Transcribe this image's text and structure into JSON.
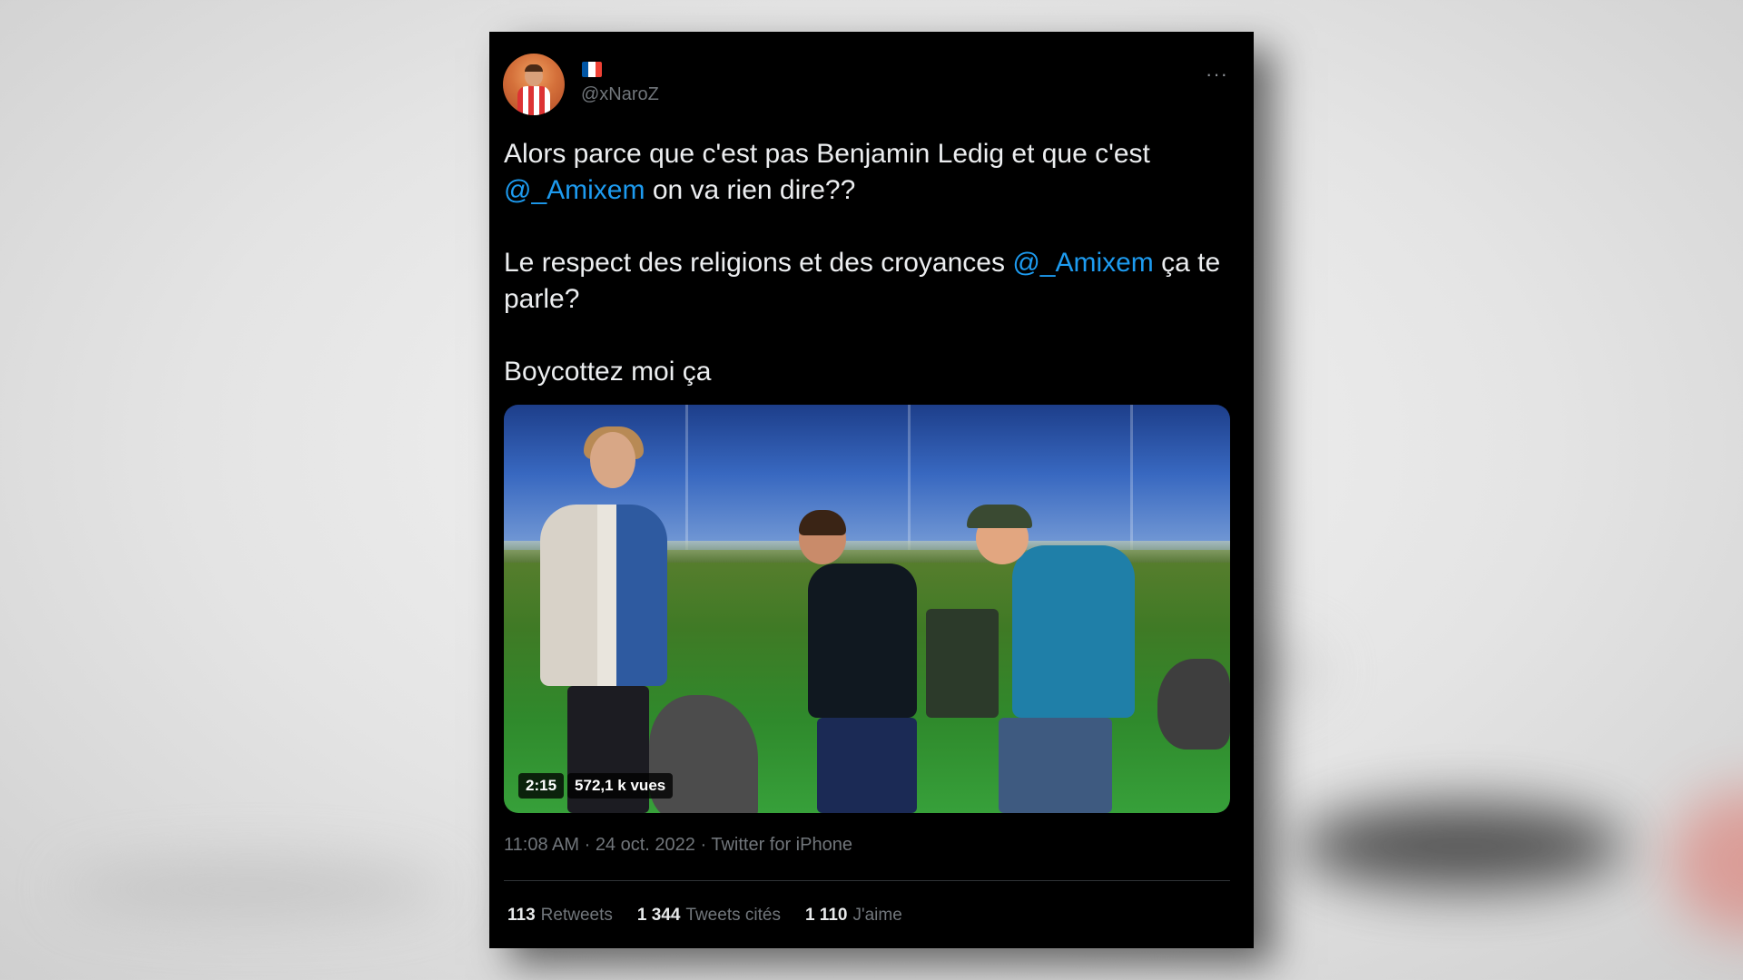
{
  "tweet": {
    "handle": "@xNaroZ",
    "flag_colors": [
      "#0055a4",
      "#ffffff",
      "#ef4135"
    ],
    "more_label": "···",
    "paragraphs": [
      {
        "before": "Alors parce que c'est pas Benjamin Ledig et que c'est ",
        "mention": "@_Amixem",
        "after": " on va rien dire??"
      },
      {
        "before": "Le respect des religions et des croyances ",
        "mention": "@_Amixem",
        "after": " ça te parle?"
      },
      {
        "before": "Boycottez moi ça",
        "mention": "",
        "after": ""
      }
    ],
    "video": {
      "duration": "2:15",
      "views": "572,1 k vues"
    },
    "time": "11:08 AM",
    "date": "24 oct. 2022",
    "source": "Twitter for iPhone",
    "stats": [
      {
        "count": "113",
        "label": "Retweets"
      },
      {
        "count": "1 344",
        "label": "Tweets cités"
      },
      {
        "count": "1 110",
        "label": "J'aime"
      }
    ]
  },
  "colors": {
    "link": "#1d9bf0",
    "background": "#000000",
    "muted": "#71767b"
  }
}
